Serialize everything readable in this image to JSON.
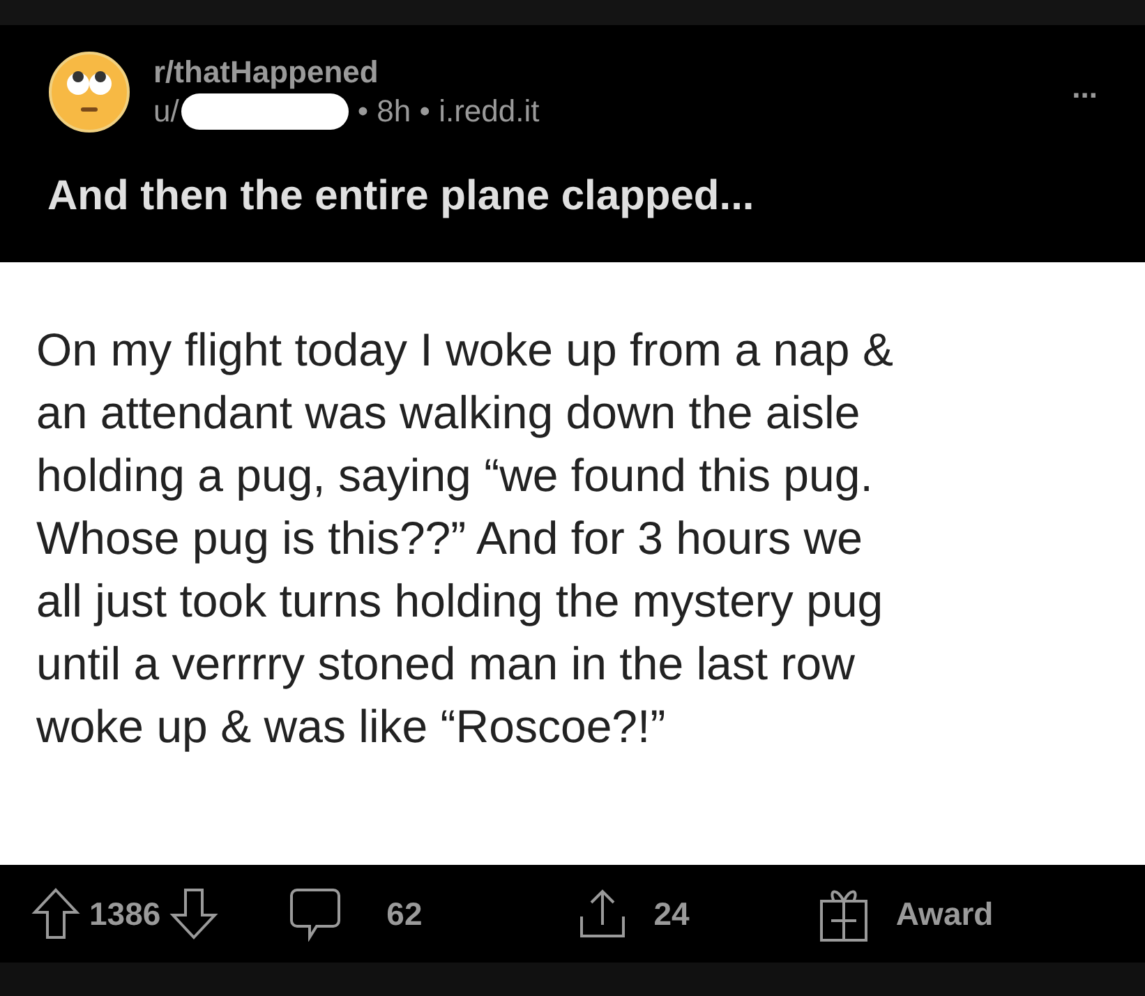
{
  "post": {
    "subreddit": "r/thatHappened",
    "user_prefix": "u/",
    "meta": "• 8h • i.redd.it",
    "more": "...",
    "title": "And then the entire plane clapped..."
  },
  "image": {
    "text": "On my flight today I woke up from a nap &\nan attendant was walking down the aisle\nholding a pug, saying “we found this pug.\nWhose pug is this??” And for 3 hours we\nall just took turns holding the mystery pug\nuntil a verrrry stoned man in the last row\nwoke up & was like “Roscoe?!”"
  },
  "actions": {
    "votes": "1386",
    "comments": "62",
    "shares": "24",
    "award": "Award"
  }
}
